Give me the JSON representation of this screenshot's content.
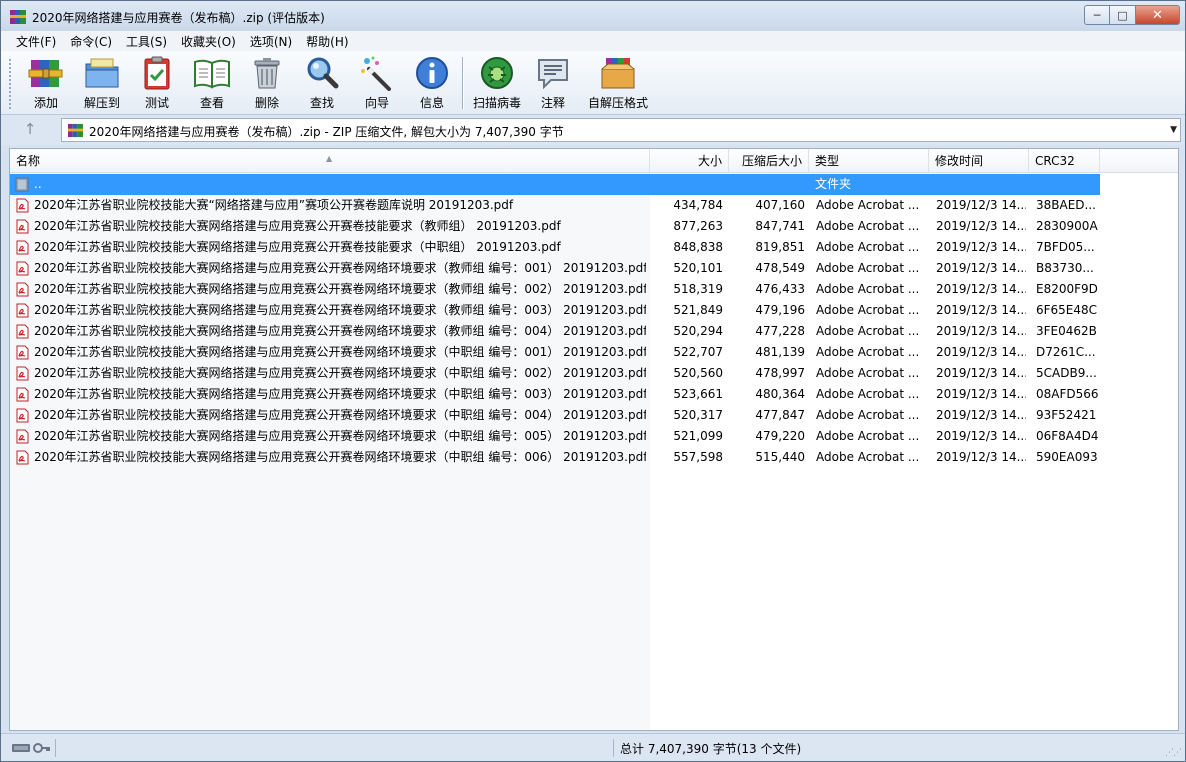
{
  "window": {
    "title": "2020年网络搭建与应用赛卷（发布稿）.zip (评估版本)",
    "buttons": {
      "minimize": "─",
      "maximize": "□",
      "close": "✕"
    }
  },
  "menu": [
    "文件(F)",
    "命令(C)",
    "工具(S)",
    "收藏夹(O)",
    "选项(N)",
    "帮助(H)"
  ],
  "toolbar": {
    "add": "添加",
    "extract": "解压到",
    "test": "测试",
    "view": "查看",
    "delete": "删除",
    "find": "查找",
    "wizard": "向导",
    "info": "信息",
    "virus": "扫描病毒",
    "comment": "注释",
    "sfx": "自解压格式"
  },
  "address": {
    "up": "↑",
    "text": "2020年网络搭建与应用赛卷（发布稿）.zip - ZIP 压缩文件, 解包大小为 7,407,390 字节",
    "dropdown": "▼"
  },
  "columns": {
    "name": "名称",
    "size": "大小",
    "packed": "压缩后大小",
    "type": "类型",
    "modified": "修改时间",
    "crc": "CRC32"
  },
  "parent_row": {
    "name": "..",
    "type": "文件夹"
  },
  "files": [
    {
      "name": "2020年江苏省职业院校技能大赛“网络搭建与应用”赛项公开赛卷题库说明  20191203.pdf",
      "size": "434,784",
      "packed": "407,160",
      "type": "Adobe Acrobat ...",
      "modified": "2019/12/3 14...",
      "crc": "38BAED..."
    },
    {
      "name": "2020年江苏省职业院校技能大赛网络搭建与应用竞赛公开赛卷技能要求（教师组） 20191203.pdf",
      "size": "877,263",
      "packed": "847,741",
      "type": "Adobe Acrobat ...",
      "modified": "2019/12/3 14...",
      "crc": "2830900A"
    },
    {
      "name": "2020年江苏省职业院校技能大赛网络搭建与应用竞赛公开赛卷技能要求（中职组） 20191203.pdf",
      "size": "848,838",
      "packed": "819,851",
      "type": "Adobe Acrobat ...",
      "modified": "2019/12/3 14...",
      "crc": "7BFD05..."
    },
    {
      "name": "2020年江苏省职业院校技能大赛网络搭建与应用竞赛公开赛卷网络环境要求（教师组  编号：001） 20191203.pdf",
      "size": "520,101",
      "packed": "478,549",
      "type": "Adobe Acrobat ...",
      "modified": "2019/12/3 14...",
      "crc": "B83730..."
    },
    {
      "name": "2020年江苏省职业院校技能大赛网络搭建与应用竞赛公开赛卷网络环境要求（教师组  编号：002） 20191203.pdf",
      "size": "518,319",
      "packed": "476,433",
      "type": "Adobe Acrobat ...",
      "modified": "2019/12/3 14...",
      "crc": "E8200F9D"
    },
    {
      "name": "2020年江苏省职业院校技能大赛网络搭建与应用竞赛公开赛卷网络环境要求（教师组  编号：003） 20191203.pdf",
      "size": "521,849",
      "packed": "479,196",
      "type": "Adobe Acrobat ...",
      "modified": "2019/12/3 14...",
      "crc": "6F65E48C"
    },
    {
      "name": "2020年江苏省职业院校技能大赛网络搭建与应用竞赛公开赛卷网络环境要求（教师组  编号：004） 20191203.pdf",
      "size": "520,294",
      "packed": "477,228",
      "type": "Adobe Acrobat ...",
      "modified": "2019/12/3 14...",
      "crc": "3FE0462B"
    },
    {
      "name": "2020年江苏省职业院校技能大赛网络搭建与应用竞赛公开赛卷网络环境要求（中职组  编号：001） 20191203.pdf",
      "size": "522,707",
      "packed": "481,139",
      "type": "Adobe Acrobat ...",
      "modified": "2019/12/3 14...",
      "crc": "D7261C..."
    },
    {
      "name": "2020年江苏省职业院校技能大赛网络搭建与应用竞赛公开赛卷网络环境要求（中职组  编号：002） 20191203.pdf",
      "size": "520,560",
      "packed": "478,997",
      "type": "Adobe Acrobat ...",
      "modified": "2019/12/3 14...",
      "crc": "5CADB9..."
    },
    {
      "name": "2020年江苏省职业院校技能大赛网络搭建与应用竞赛公开赛卷网络环境要求（中职组  编号：003） 20191203.pdf",
      "size": "523,661",
      "packed": "480,364",
      "type": "Adobe Acrobat ...",
      "modified": "2019/12/3 14...",
      "crc": "08AFD566"
    },
    {
      "name": "2020年江苏省职业院校技能大赛网络搭建与应用竞赛公开赛卷网络环境要求（中职组  编号：004） 20191203.pdf",
      "size": "520,317",
      "packed": "477,847",
      "type": "Adobe Acrobat ...",
      "modified": "2019/12/3 14...",
      "crc": "93F52421"
    },
    {
      "name": "2020年江苏省职业院校技能大赛网络搭建与应用竞赛公开赛卷网络环境要求（中职组  编号：005） 20191203.pdf",
      "size": "521,099",
      "packed": "479,220",
      "type": "Adobe Acrobat ...",
      "modified": "2019/12/3 14...",
      "crc": "06F8A4D4"
    },
    {
      "name": "2020年江苏省职业院校技能大赛网络搭建与应用竞赛公开赛卷网络环境要求（中职组  编号：006） 20191203.pdf",
      "size": "557,598",
      "packed": "515,440",
      "type": "Adobe Acrobat ...",
      "modified": "2019/12/3 14...",
      "crc": "590EA093"
    }
  ],
  "status": {
    "total": "总计 7,407,390 字节(13 个文件)"
  }
}
